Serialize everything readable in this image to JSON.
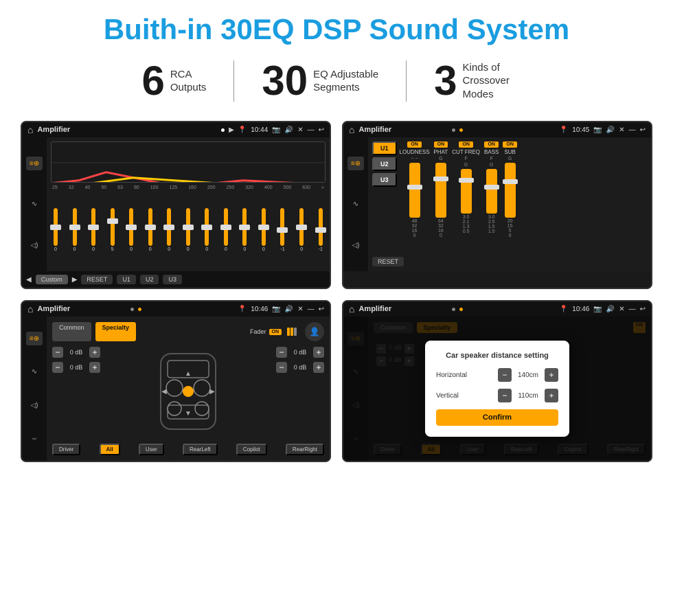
{
  "page": {
    "title": "Buith-in 30EQ DSP Sound System",
    "stats": [
      {
        "number": "6",
        "text": "RCA\nOutputs"
      },
      {
        "number": "30",
        "text": "EQ Adjustable\nSegments"
      },
      {
        "number": "3",
        "text": "Kinds of\nCrossover Modes"
      }
    ]
  },
  "screens": {
    "eq_screen": {
      "title": "Amplifier",
      "time": "10:44",
      "freqs": [
        "25",
        "32",
        "40",
        "50",
        "63",
        "80",
        "100",
        "125",
        "160",
        "200",
        "250",
        "320",
        "400",
        "500",
        "630"
      ],
      "values": [
        "0",
        "0",
        "0",
        "5",
        "0",
        "0",
        "0",
        "0",
        "0",
        "0",
        "0",
        "0",
        "-1",
        "0",
        "-1"
      ],
      "bottom_buttons": [
        "◀",
        "Custom",
        "▶",
        "RESET",
        "U1",
        "U2",
        "U3"
      ]
    },
    "crossover_screen": {
      "title": "Amplifier",
      "time": "10:45",
      "presets": [
        "U1",
        "U2",
        "U3"
      ],
      "channels": [
        {
          "on": true,
          "name": "LOUDNESS"
        },
        {
          "on": true,
          "name": "PHAT"
        },
        {
          "on": true,
          "name": "CUT FREQ"
        },
        {
          "on": true,
          "name": "BASS"
        },
        {
          "on": true,
          "name": "SUB"
        }
      ],
      "reset_label": "RESET"
    },
    "fader_screen": {
      "title": "Amplifier",
      "time": "10:46",
      "tabs": [
        "Common",
        "Specialty"
      ],
      "fader_label": "Fader",
      "fader_on": "ON",
      "db_values": [
        "0 dB",
        "0 dB",
        "0 dB",
        "0 dB"
      ],
      "bottom_buttons": [
        "Driver",
        "All",
        "User",
        "RearLeft",
        "Copilot",
        "RearRight"
      ]
    },
    "distance_screen": {
      "title": "Amplifier",
      "time": "10:46",
      "tabs": [
        "Common",
        "Specialty"
      ],
      "dialog": {
        "title": "Car speaker distance setting",
        "horizontal_label": "Horizontal",
        "horizontal_value": "140cm",
        "vertical_label": "Vertical",
        "vertical_value": "110cm",
        "confirm_label": "Confirm"
      }
    }
  }
}
